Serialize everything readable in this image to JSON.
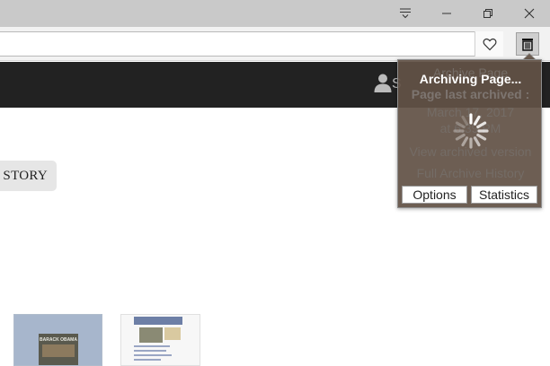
{
  "titlebar": {
    "icons": [
      "tab-list-icon",
      "minimize-icon",
      "restore-icon",
      "close-icon"
    ]
  },
  "toolbar": {
    "favorite_icon": "heart-icon",
    "extension_icon": "archive-icon"
  },
  "site": {
    "user_icon": "user-icon",
    "user_text": "S",
    "history_button": "STORY"
  },
  "popup": {
    "title": "Archiving Page...",
    "background_lines": [
      "Archive Page",
      "Page last archived :",
      "March 17, 2017",
      "at 6:39 PM",
      "View archived version",
      "Full Archive History"
    ],
    "options_label": "Options",
    "statistics_label": "Statistics"
  },
  "thumbnails": [
    {
      "caption": "BARACK OBAMA"
    },
    {
      "caption": ""
    }
  ],
  "colors": {
    "titlebar": "#c9c9c9",
    "sitebar": "#222222",
    "popup_bg": "#625246"
  }
}
